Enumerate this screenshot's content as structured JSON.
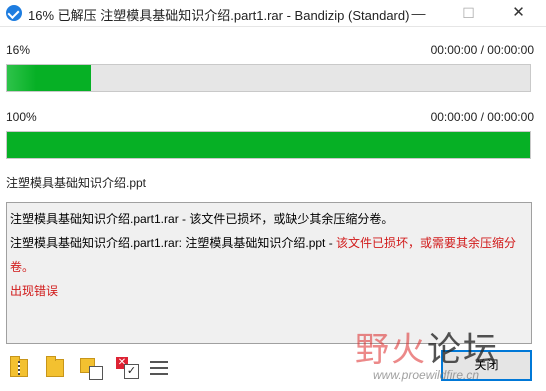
{
  "window": {
    "title": "16% 已解压 注塑模具基础知识介绍.part1.rar - Bandizip (Standard)",
    "minimize_glyph": "—",
    "maximize_glyph": "☐",
    "close_glyph": "✕"
  },
  "progress_file": {
    "percent_label": "16%",
    "time": "00:00:00 / 00:00:00",
    "fraction": 0.16,
    "color": "#06b025"
  },
  "progress_total": {
    "percent_label": "100%",
    "time": "00:00:00 / 00:00:00",
    "fraction": 1.0,
    "color": "#06b025"
  },
  "current_file": "注塑模具基础知识介绍.ppt",
  "log": {
    "line1": "注塑模具基础知识介绍.part1.rar - 该文件已损坏，或缺少其余压缩分卷。",
    "line2_black": "注塑模具基础知识介绍.part1.rar: 注塑模具基础知识介绍.ppt - ",
    "line2_red": "该文件已损坏，或需要其余压缩分卷。",
    "line3": "出现错误",
    "error_color": "#d11a1a"
  },
  "toolbar": {
    "icons": [
      "zip-folder-icon",
      "folder-icon",
      "multi-file-icon",
      "close-on-finish-icon",
      "menu-icon"
    ],
    "check_glyph": "✓",
    "x_glyph": "✕"
  },
  "close_button": {
    "label": "关闭"
  },
  "watermark": {
    "chars_red": "野火",
    "chars_dark": "论坛",
    "url": "www.proewildfire.cn"
  }
}
